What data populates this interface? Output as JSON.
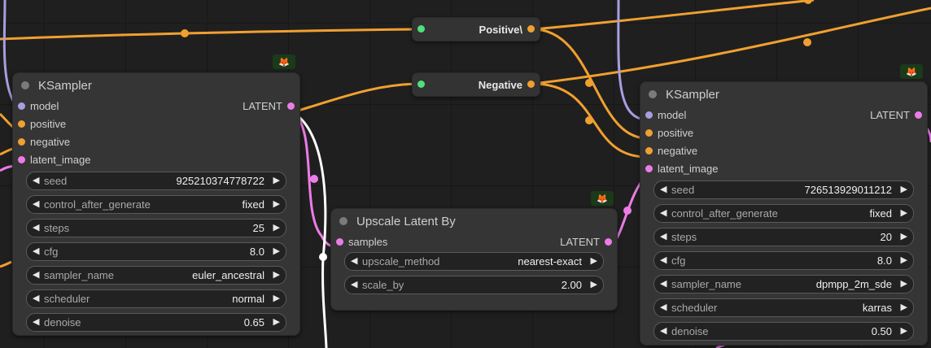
{
  "colors": {
    "wire_conditioning": "#f0a030",
    "wire_model": "#a99ee0",
    "wire_latent": "#ec7ce8",
    "wire_image": "#ffffff",
    "canvas_bg": "#1f1f1f"
  },
  "prompts": {
    "positive_label": "Positive\\",
    "negative_label": "Negative"
  },
  "badge_icon": "fox-icon",
  "ksampler_left": {
    "title": "KSampler",
    "inputs": [
      "model",
      "positive",
      "negative",
      "latent_image"
    ],
    "output": "LATENT",
    "widgets": [
      {
        "name": "seed",
        "value": "925210374778722"
      },
      {
        "name": "control_after_generate",
        "value": "fixed"
      },
      {
        "name": "steps",
        "value": "25"
      },
      {
        "name": "cfg",
        "value": "8.0"
      },
      {
        "name": "sampler_name",
        "value": "euler_ancestral"
      },
      {
        "name": "scheduler",
        "value": "normal"
      },
      {
        "name": "denoise",
        "value": "0.65"
      }
    ]
  },
  "upscale": {
    "title": "Upscale Latent By",
    "input": "samples",
    "output": "LATENT",
    "widgets": [
      {
        "name": "upscale_method",
        "value": "nearest-exact"
      },
      {
        "name": "scale_by",
        "value": "2.00"
      }
    ]
  },
  "ksampler_right": {
    "title": "KSampler",
    "inputs": [
      "model",
      "positive",
      "negative",
      "latent_image"
    ],
    "output": "LATENT",
    "widgets": [
      {
        "name": "seed",
        "value": "726513929011212"
      },
      {
        "name": "control_after_generate",
        "value": "fixed"
      },
      {
        "name": "steps",
        "value": "20"
      },
      {
        "name": "cfg",
        "value": "8.0"
      },
      {
        "name": "sampler_name",
        "value": "dpmpp_2m_sde"
      },
      {
        "name": "scheduler",
        "value": "karras"
      },
      {
        "name": "denoise",
        "value": "0.50"
      }
    ]
  },
  "arrows": {
    "left": "◀",
    "right": "▶"
  }
}
